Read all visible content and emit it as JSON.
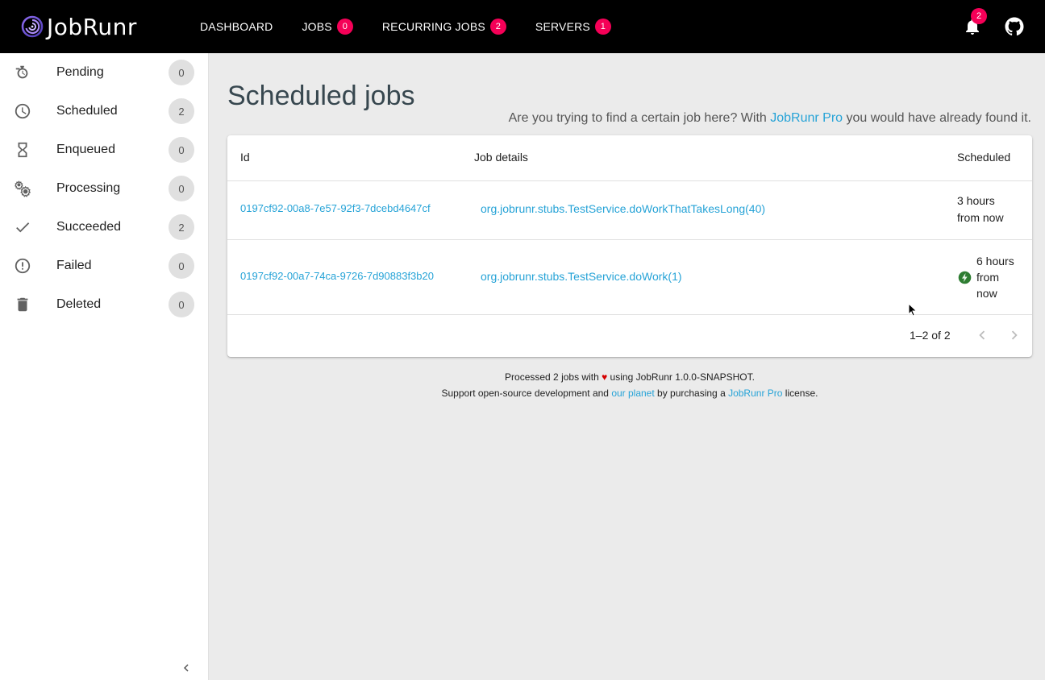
{
  "brand": {
    "name": "JobRunr"
  },
  "nav": [
    {
      "label": "DASHBOARD",
      "badge": null
    },
    {
      "label": "JOBS",
      "badge": "0"
    },
    {
      "label": "RECURRING JOBS",
      "badge": "2"
    },
    {
      "label": "SERVERS",
      "badge": "1"
    }
  ],
  "notifications": {
    "count": "2"
  },
  "sidebar": {
    "items": [
      {
        "label": "Pending",
        "count": "0",
        "icon": "pending-icon"
      },
      {
        "label": "Scheduled",
        "count": "2",
        "icon": "clock-icon"
      },
      {
        "label": "Enqueued",
        "count": "0",
        "icon": "hourglass-icon"
      },
      {
        "label": "Processing",
        "count": "0",
        "icon": "gears-icon"
      },
      {
        "label": "Succeeded",
        "count": "2",
        "icon": "check-icon"
      },
      {
        "label": "Failed",
        "count": "0",
        "icon": "error-icon"
      },
      {
        "label": "Deleted",
        "count": "0",
        "icon": "trash-icon"
      }
    ]
  },
  "page": {
    "title": "Scheduled jobs",
    "pro_prefix": "Are you trying to find a certain job here? With ",
    "pro_link": "JobRunr Pro",
    "pro_suffix": " you would have already found it."
  },
  "table": {
    "headers": {
      "id": "Id",
      "details": "Job details",
      "scheduled": "Scheduled"
    },
    "rows": [
      {
        "id": "0197cf92-00a8-7e57-92f3-7dcebd4647cf",
        "details": "org.jobrunr.stubs.TestService.doWorkThatTakesLong(40)",
        "scheduled_l1": "3 hours",
        "scheduled_l2": "from now",
        "scheduled_l3": ""
      },
      {
        "id": "0197cf92-00a7-74ca-9726-7d90883f3b20",
        "details": "org.jobrunr.stubs.TestService.doWork(1)",
        "scheduled_l1": "6 hours",
        "scheduled_l2": "from",
        "scheduled_l3": "now"
      }
    ],
    "pagination": "1–2 of 2"
  },
  "footer": {
    "line1_prefix": "Processed 2 jobs with ",
    "heart": "♥",
    "line1_suffix": " using JobRunr 1.0.0-SNAPSHOT.",
    "line2_prefix": "Support open-source development and ",
    "line2_link1": "our planet",
    "line2_mid": " by purchasing a ",
    "line2_link2": "JobRunr Pro",
    "line2_suffix": " license."
  },
  "colors": {
    "accent": "#26a3d7",
    "badge": "#f50057",
    "topbar": "#000000"
  }
}
